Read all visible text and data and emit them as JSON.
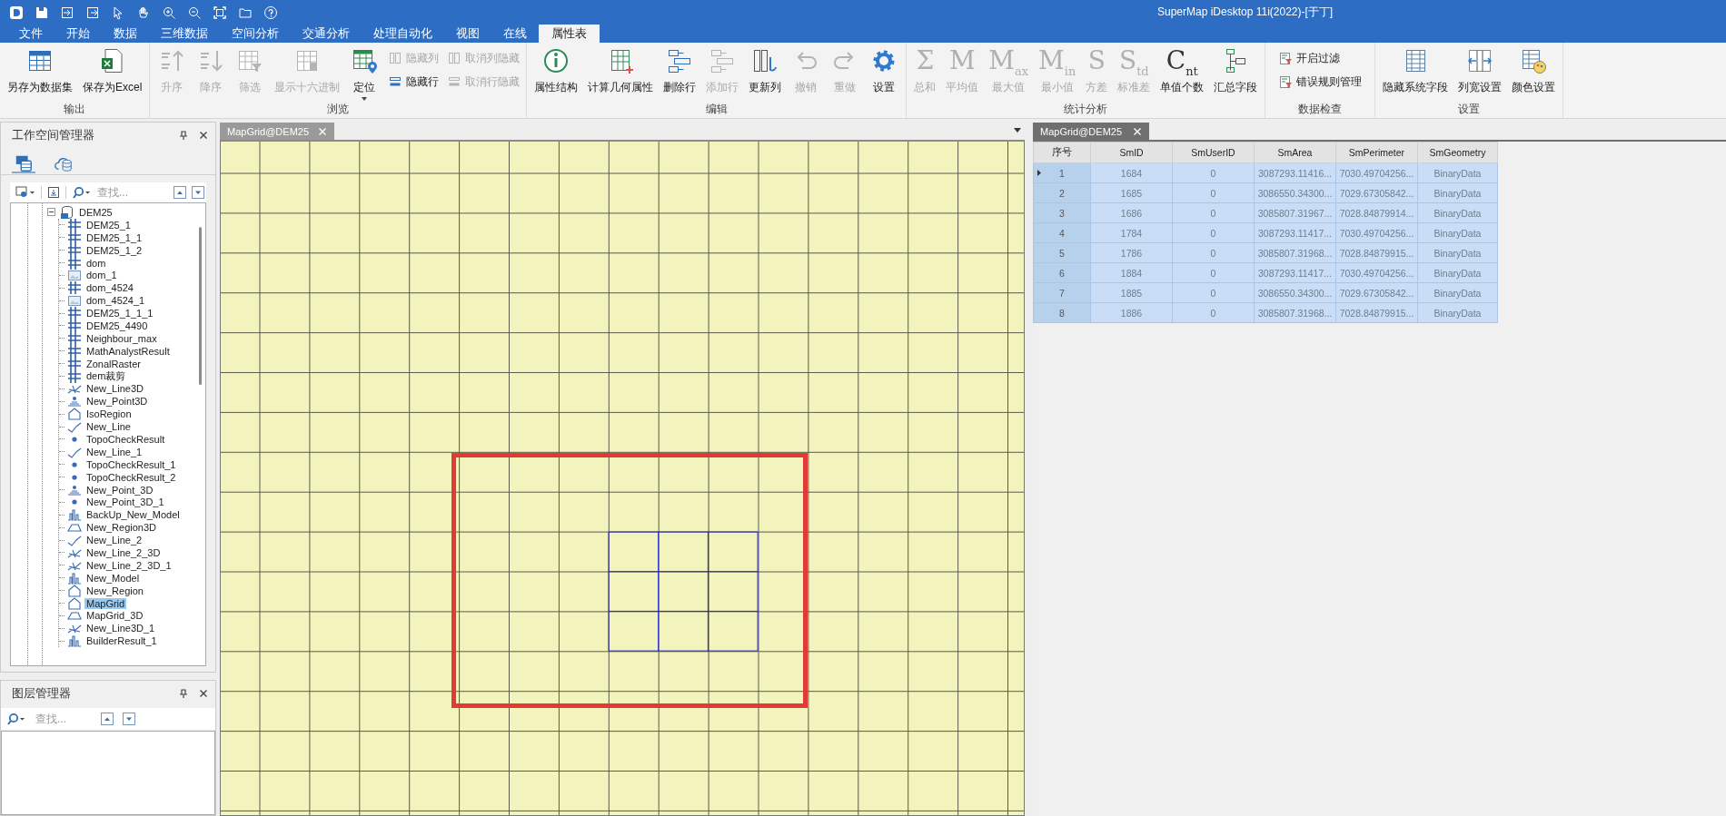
{
  "window": {
    "title": "SuperMap iDesktop 11i(2022)-[于丁]"
  },
  "menu_tabs": [
    {
      "label": "文件",
      "selected": false
    },
    {
      "label": "开始",
      "selected": false
    },
    {
      "label": "数据",
      "selected": false
    },
    {
      "label": "三维数据",
      "selected": false
    },
    {
      "label": "空间分析",
      "selected": false
    },
    {
      "label": "交通分析",
      "selected": false
    },
    {
      "label": "处理自动化",
      "selected": false
    },
    {
      "label": "视图",
      "selected": false
    },
    {
      "label": "在线",
      "selected": false
    },
    {
      "label": "属性表",
      "selected": true
    }
  ],
  "ribbon": {
    "groups": [
      {
        "label": "输出",
        "buttons": [
          {
            "label": "另存为数据集",
            "kind": "large",
            "disabled": false
          },
          {
            "label": "保存为Excel",
            "kind": "large",
            "disabled": false
          }
        ]
      },
      {
        "label": "浏览",
        "buttons": [
          {
            "label": "升序",
            "kind": "large",
            "disabled": true
          },
          {
            "label": "降序",
            "kind": "large",
            "disabled": true
          },
          {
            "label": "筛选",
            "kind": "large",
            "disabled": true
          },
          {
            "label": "显示十六进制",
            "kind": "large",
            "disabled": true
          },
          {
            "label": "定位",
            "kind": "large",
            "disabled": false,
            "dropdown": true
          },
          {
            "label": "隐藏列",
            "kind": "small",
            "disabled": true
          },
          {
            "label": "隐藏行",
            "kind": "small",
            "disabled": false
          },
          {
            "label": "取消列隐藏",
            "kind": "small",
            "disabled": true
          },
          {
            "label": "取消行隐藏",
            "kind": "small",
            "disabled": true
          }
        ]
      },
      {
        "label": "编辑",
        "buttons": [
          {
            "label": "属性结构",
            "kind": "large",
            "disabled": false
          },
          {
            "label": "计算几何属性",
            "kind": "large",
            "disabled": false
          },
          {
            "label": "删除行",
            "kind": "large",
            "disabled": false
          },
          {
            "label": "添加行",
            "kind": "large",
            "disabled": true
          },
          {
            "label": "更新列",
            "kind": "large",
            "disabled": false
          },
          {
            "label": "撤销",
            "kind": "large",
            "disabled": true
          },
          {
            "label": "重做",
            "kind": "large",
            "disabled": true
          },
          {
            "label": "设置",
            "kind": "large",
            "disabled": false
          }
        ]
      },
      {
        "label": "统计分析",
        "buttons": [
          {
            "label": "总和",
            "kind": "large",
            "disabled": true,
            "glyph": "Σ"
          },
          {
            "label": "平均值",
            "kind": "large",
            "disabled": true,
            "glyph": "M"
          },
          {
            "label": "最大值",
            "kind": "large",
            "disabled": true,
            "glyph": "M$_{ax}$"
          },
          {
            "label": "最小值",
            "kind": "large",
            "disabled": true,
            "glyph": "M$_{in}$"
          },
          {
            "label": "方差",
            "kind": "large",
            "disabled": true,
            "glyph": "S"
          },
          {
            "label": "标准差",
            "kind": "large",
            "disabled": true,
            "glyph": "S$_{td}$"
          },
          {
            "label": "单值个数",
            "kind": "large",
            "disabled": false,
            "glyph": "C$_{nt}$"
          },
          {
            "label": "汇总字段",
            "kind": "large",
            "disabled": false
          }
        ]
      },
      {
        "label": "数据检查",
        "buttons": [
          {
            "label": "开启过滤",
            "kind": "small",
            "disabled": false
          },
          {
            "label": "错误规则管理",
            "kind": "small",
            "disabled": false
          }
        ]
      },
      {
        "label": "设置",
        "buttons": [
          {
            "label": "隐藏系统字段",
            "kind": "large",
            "disabled": false
          },
          {
            "label": "列宽设置",
            "kind": "large",
            "disabled": false
          },
          {
            "label": "颜色设置",
            "kind": "large",
            "disabled": false
          }
        ]
      }
    ]
  },
  "workspace_manager": {
    "title": "工作空间管理器",
    "tabs": [
      {
        "selected": true
      },
      {
        "selected": false
      }
    ],
    "search": {
      "placeholder": "查找..."
    },
    "tree": [
      {
        "label": "DEM25",
        "kind": "datasource",
        "expanded": true,
        "selected": false,
        "children": [
          {
            "label": "DEM25_1",
            "kind": "grid",
            "selected": false
          },
          {
            "label": "DEM25_1_1",
            "kind": "grid",
            "selected": false
          },
          {
            "label": "DEM25_1_2",
            "kind": "grid",
            "selected": false
          },
          {
            "label": "dom",
            "kind": "grid",
            "selected": false
          },
          {
            "label": "dom_1",
            "kind": "image",
            "selected": false
          },
          {
            "label": "dom_4524",
            "kind": "grid",
            "selected": false
          },
          {
            "label": "dom_4524_1",
            "kind": "image",
            "selected": false
          },
          {
            "label": "DEM25_1_1_1",
            "kind": "grid",
            "selected": false
          },
          {
            "label": "DEM25_4490",
            "kind": "grid",
            "selected": false
          },
          {
            "label": "Neighbour_max",
            "kind": "grid",
            "selected": false
          },
          {
            "label": "MathAnalystResult",
            "kind": "grid",
            "selected": false
          },
          {
            "label": "ZonalRaster",
            "kind": "grid",
            "selected": false
          },
          {
            "label": "dem裁剪",
            "kind": "grid",
            "selected": false
          },
          {
            "label": "New_Line3D",
            "kind": "line3d",
            "selected": false
          },
          {
            "label": "New_Point3D",
            "kind": "point3d",
            "selected": false
          },
          {
            "label": "IsoRegion",
            "kind": "region",
            "selected": false
          },
          {
            "label": "New_Line",
            "kind": "line",
            "selected": false
          },
          {
            "label": "TopoCheckResult",
            "kind": "point",
            "selected": false
          },
          {
            "label": "New_Line_1",
            "kind": "line",
            "selected": false
          },
          {
            "label": "TopoCheckResult_1",
            "kind": "point",
            "selected": false
          },
          {
            "label": "TopoCheckResult_2",
            "kind": "point",
            "selected": false
          },
          {
            "label": "New_Point_3D",
            "kind": "point3d",
            "selected": false
          },
          {
            "label": "New_Point_3D_1",
            "kind": "point",
            "selected": false
          },
          {
            "label": "BackUp_New_Model",
            "kind": "model",
            "selected": false
          },
          {
            "label": "New_Region3D",
            "kind": "region3d",
            "selected": false
          },
          {
            "label": "New_Line_2",
            "kind": "line",
            "selected": false
          },
          {
            "label": "New_Line_2_3D",
            "kind": "line3d",
            "selected": false
          },
          {
            "label": "New_Line_2_3D_1",
            "kind": "line3d",
            "selected": false
          },
          {
            "label": "New_Model",
            "kind": "model",
            "selected": false
          },
          {
            "label": "New_Region",
            "kind": "region",
            "selected": false
          },
          {
            "label": "MapGrid",
            "kind": "region",
            "selected": true
          },
          {
            "label": "MapGrid_3D",
            "kind": "region3d",
            "selected": false
          },
          {
            "label": "New_Line3D_1",
            "kind": "line3d",
            "selected": false
          },
          {
            "label": "BuilderResult_1",
            "kind": "model",
            "selected": false
          }
        ]
      }
    ]
  },
  "layer_manager": {
    "title": "图层管理器",
    "search": {
      "placeholder": "查找..."
    }
  },
  "map_view": {
    "tab": {
      "label": "MapGrid@DEM25"
    }
  },
  "attribute_table": {
    "tab": {
      "label": "MapGrid@DEM25"
    },
    "columns": [
      "序号",
      "SmID",
      "SmUserID",
      "SmArea",
      "SmPerimeter",
      "SmGeometry"
    ],
    "rows": [
      {
        "current": true,
        "selected": true,
        "cells": [
          "1",
          "1684",
          "0",
          "3087293.11416...",
          "7030.49704256...",
          "BinaryData"
        ]
      },
      {
        "current": false,
        "selected": true,
        "cells": [
          "2",
          "1685",
          "0",
          "3086550.34300...",
          "7029.67305842...",
          "BinaryData"
        ]
      },
      {
        "current": false,
        "selected": true,
        "cells": [
          "3",
          "1686",
          "0",
          "3085807.31967...",
          "7028.84879914...",
          "BinaryData"
        ]
      },
      {
        "current": false,
        "selected": true,
        "cells": [
          "4",
          "1784",
          "0",
          "3087293.11417...",
          "7030.49704256...",
          "BinaryData"
        ]
      },
      {
        "current": false,
        "selected": true,
        "cells": [
          "5",
          "1786",
          "0",
          "3085807.31968...",
          "7028.84879915...",
          "BinaryData"
        ]
      },
      {
        "current": false,
        "selected": true,
        "cells": [
          "6",
          "1884",
          "0",
          "3087293.11417...",
          "7030.49704256...",
          "BinaryData"
        ]
      },
      {
        "current": false,
        "selected": true,
        "cells": [
          "7",
          "1885",
          "0",
          "3086550.34300...",
          "7029.67305842...",
          "BinaryData"
        ]
      },
      {
        "current": false,
        "selected": true,
        "cells": [
          "8",
          "1886",
          "0",
          "3085807.31968...",
          "7028.84879915...",
          "BinaryData"
        ]
      }
    ]
  }
}
